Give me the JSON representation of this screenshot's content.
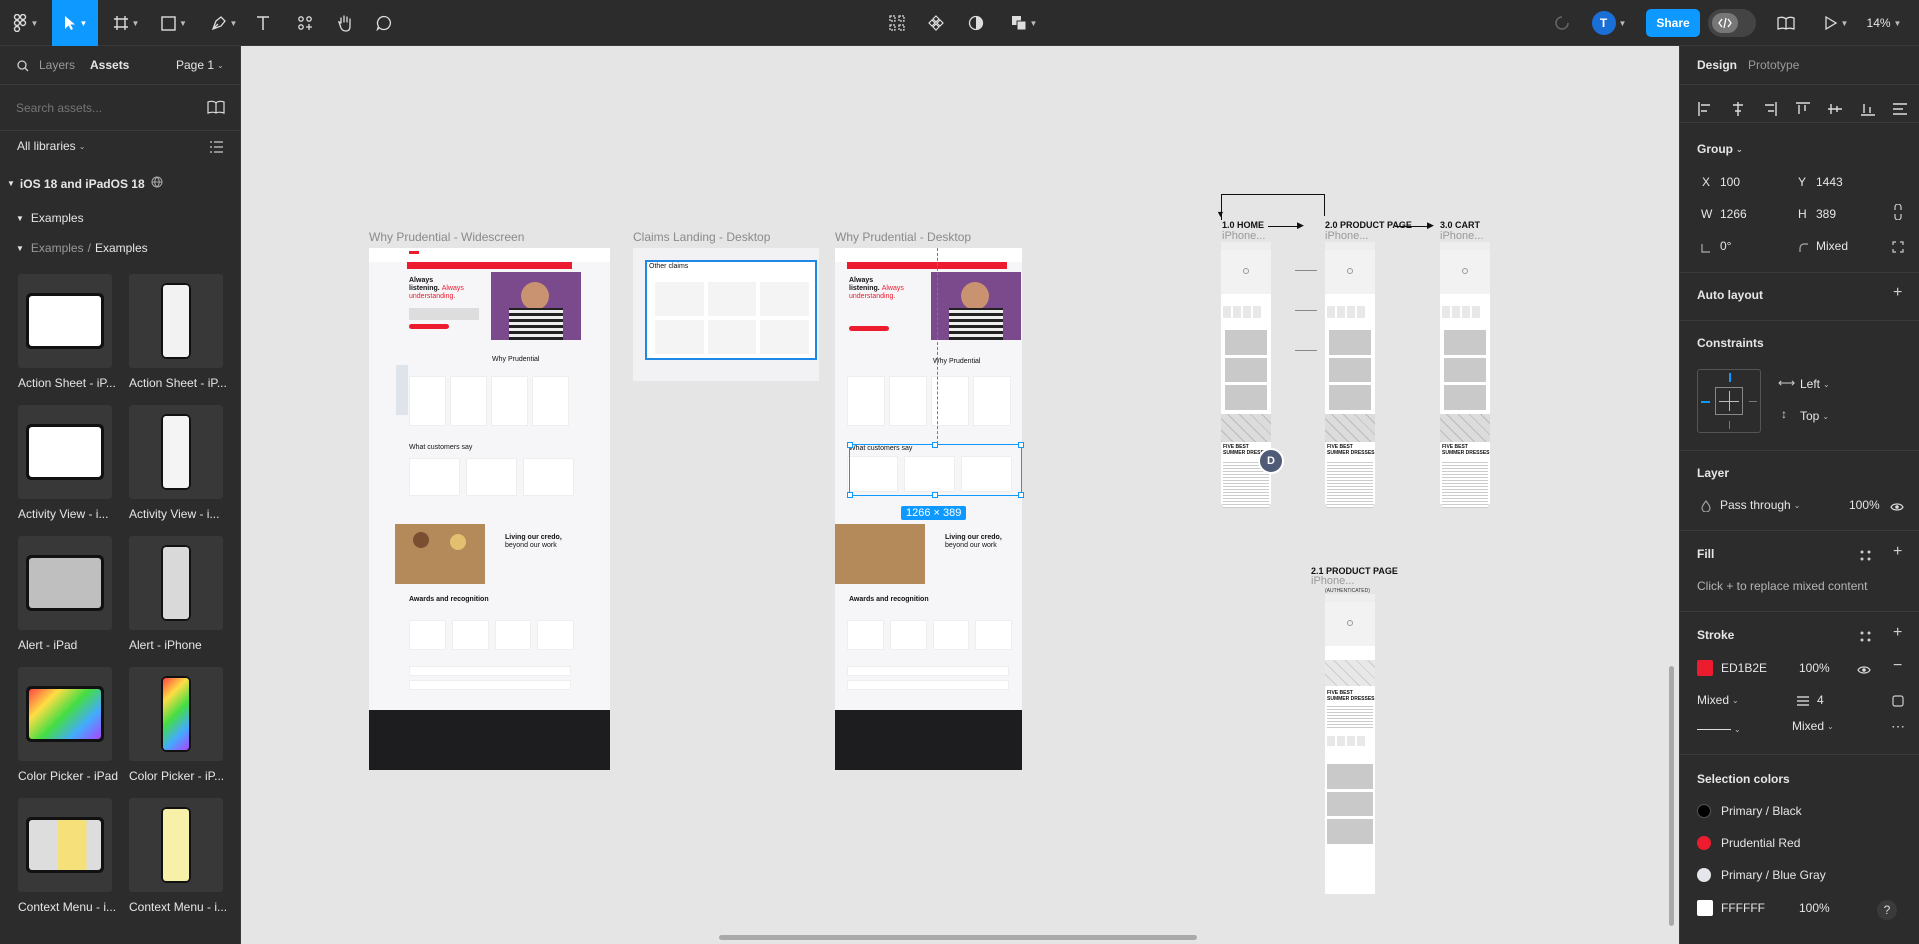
{
  "toolbar": {
    "share_label": "Share",
    "avatar_initial": "T",
    "zoom": "14%"
  },
  "left_panel": {
    "tabs": [
      "Layers",
      "Assets"
    ],
    "page_selector": "Page 1",
    "search_placeholder": "Search assets...",
    "libraries_label": "All libraries",
    "library_name": "iOS 18 and iPadOS 18",
    "section_examples": "Examples",
    "breadcrumb_parent": "Examples",
    "breadcrumb_sep": "/",
    "breadcrumb_current": "Examples",
    "components": [
      {
        "label": "Action Sheet - iP...",
        "kind": "ipad"
      },
      {
        "label": "Action Sheet - iP...",
        "kind": "iphone"
      },
      {
        "label": "Activity View - i...",
        "kind": "ipad"
      },
      {
        "label": "Activity View - i...",
        "kind": "iphone"
      },
      {
        "label": "Alert - iPad",
        "kind": "ipad"
      },
      {
        "label": "Alert - iPhone",
        "kind": "iphone"
      },
      {
        "label": "Color Picker - iPad",
        "kind": "ipad"
      },
      {
        "label": "Color Picker - iP...",
        "kind": "iphone"
      },
      {
        "label": "Context Menu - i...",
        "kind": "ipad"
      },
      {
        "label": "Context Menu - i...",
        "kind": "iphone"
      }
    ]
  },
  "canvas": {
    "frames": [
      {
        "title": "Why Prudential - Widescreen"
      },
      {
        "title": "Claims Landing - Desktop"
      },
      {
        "title": "Why Prudential - Desktop"
      }
    ],
    "wide_texts": {
      "hero_a": "Always",
      "hero_b": "listening.",
      "hero_c": "Always",
      "hero_d": "understanding.",
      "why": "Why Prudential",
      "customers": "What customers say",
      "living_a": "Living our credo,",
      "living_b": "beyond our work",
      "awards": "Awards and recognition"
    },
    "claims_texts": {
      "other_claims": "Other claims"
    },
    "selection_size": "1266 × 389",
    "collaborator_initial": "D",
    "flow": {
      "home": "1.0 HOME",
      "product": "2.0 PRODUCT PAGE",
      "cart": "3.0 CART",
      "product_auth": "2.1 PRODUCT PAGE",
      "product_auth_sub": "(AUTHENTICATED)",
      "iphone_label": "iPhone...",
      "dresses_a": "FIVE BEST",
      "dresses_b": "SUMMER DRESSES"
    }
  },
  "right_panel": {
    "tabs": [
      "Design",
      "Prototype"
    ],
    "group_label": "Group",
    "x_label": "X",
    "x_value": "100",
    "y_label": "Y",
    "y_value": "1443",
    "w_label": "W",
    "w_value": "1266",
    "h_label": "H",
    "h_value": "389",
    "rotation": "0°",
    "radius": "Mixed",
    "auto_layout": "Auto layout",
    "constraints": "Constraints",
    "constraint_h": "Left",
    "constraint_v": "Top",
    "layer": "Layer",
    "blend": "Pass through",
    "layer_opacity": "100%",
    "fill": "Fill",
    "fill_hint": "Click + to replace mixed content",
    "stroke": "Stroke",
    "stroke_hex": "ED1B2E",
    "stroke_opacity": "100%",
    "stroke_position": "Mixed",
    "stroke_weight": "4",
    "stroke_style": "Mixed",
    "selection_colors": "Selection colors",
    "colors": [
      {
        "name": "Primary / Black",
        "hex": "#000000"
      },
      {
        "name": "Prudential Red",
        "hex": "#ED1B2E"
      },
      {
        "name": "Primary / Blue Gray",
        "hex": "#E4E6EB"
      }
    ],
    "extra_color_hex": "FFFFFF",
    "extra_color_opacity": "100%",
    "help": "?"
  },
  "colors": {
    "accent": "#0d99ff",
    "brand_red": "#ED1B2E",
    "toolbar_bg": "#2c2c2c",
    "canvas_bg": "#e5e5e5"
  }
}
